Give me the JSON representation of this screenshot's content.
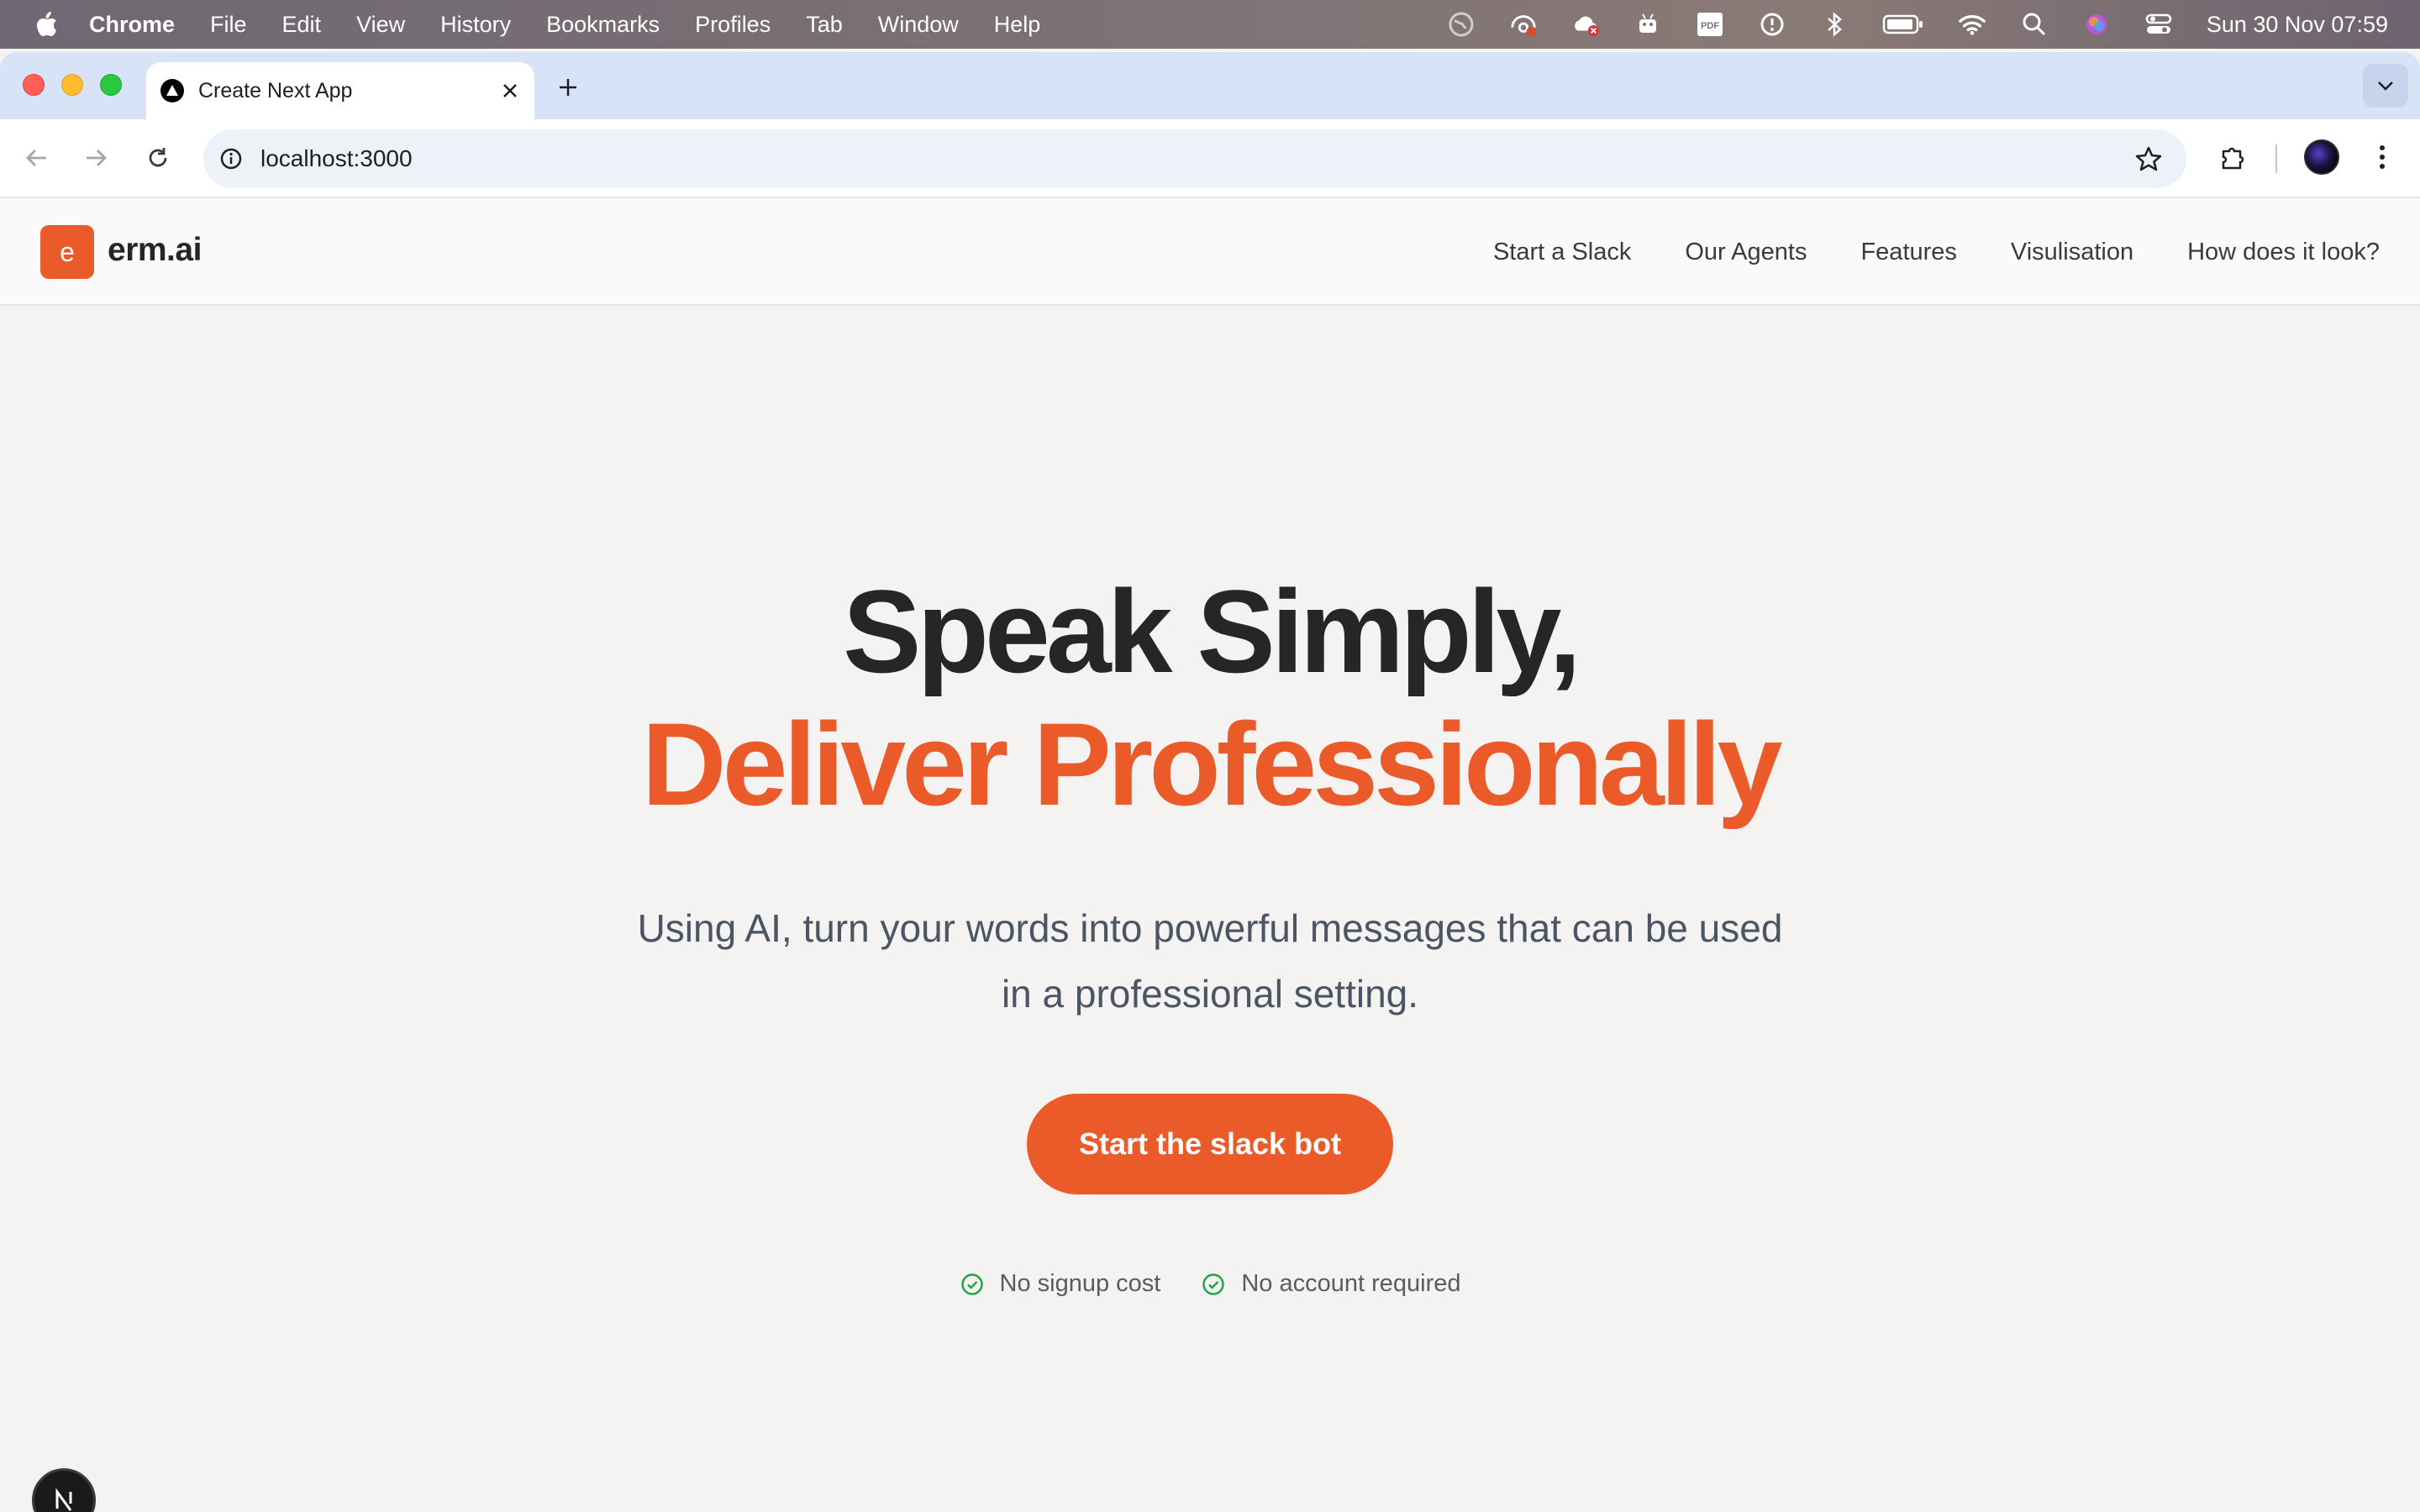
{
  "menubar": {
    "app_name": "Chrome",
    "items": [
      "File",
      "Edit",
      "View",
      "History",
      "Bookmarks",
      "Profiles",
      "Tab",
      "Window",
      "Help"
    ],
    "clock": "Sun 30 Nov  07:59"
  },
  "browser": {
    "tab_title": "Create Next App",
    "url": "localhost:3000"
  },
  "site": {
    "logo_letter": "e",
    "logo_text": "erm.ai",
    "nav": [
      "Start a Slack",
      "Our Agents",
      "Features",
      "Visulisation",
      "How does it look?"
    ]
  },
  "hero": {
    "headline_line1": "Speak Simply,",
    "headline_line2": "Deliver Professionally",
    "subtitle": "Using AI, turn your words into powerful messages that can be used in a professional setting.",
    "cta_label": "Start the slack bot",
    "checks": [
      "No signup cost",
      "No account required"
    ]
  },
  "colors": {
    "accent": "#eb5b2a",
    "check_green": "#22a447",
    "heading": "#262626"
  },
  "icons": {
    "next_badge": "N"
  }
}
